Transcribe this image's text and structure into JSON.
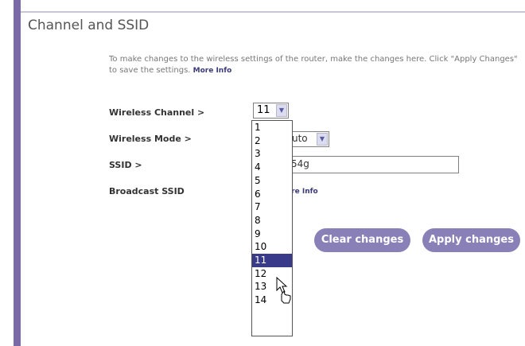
{
  "section": {
    "title": "Channel and SSID",
    "intro": "To make changes to the wireless settings of the router, make the changes here. Click \"Apply Changes\" to save the settings.",
    "more_info": "More Info"
  },
  "fields": {
    "channel_label": "Wireless Channel >",
    "channel_value": "11",
    "mode_label": "Wireless Mode >",
    "mode_value": "uto",
    "ssid_label": "SSID >",
    "ssid_value": "54g",
    "broadcast_label": "Broadcast SSID",
    "more_info": "ore Info"
  },
  "channel_dropdown": {
    "options": [
      "1",
      "2",
      "3",
      "4",
      "5",
      "6",
      "7",
      "8",
      "9",
      "10",
      "11",
      "12",
      "13",
      "14"
    ],
    "selected": "11"
  },
  "buttons": {
    "clear": "Clear changes",
    "apply": "Apply changes"
  },
  "colors": {
    "accent": "#7a6aa8",
    "button": "#8a80b8",
    "selection": "#3a3a8a"
  }
}
